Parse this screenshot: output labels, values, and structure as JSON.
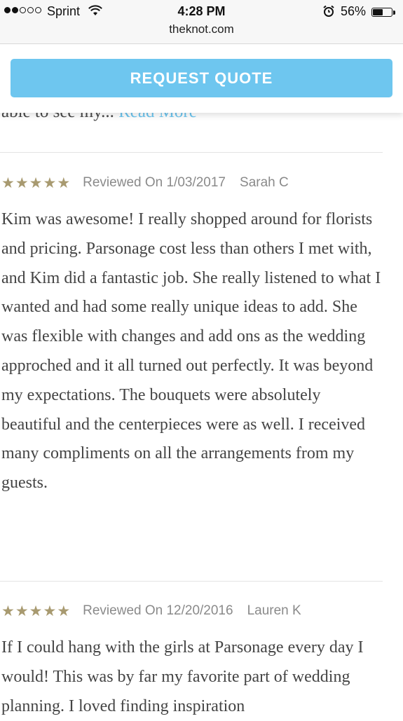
{
  "status_bar": {
    "carrier": "Sprint",
    "time": "4:28 PM",
    "battery_percent": "56%",
    "battery_level": 0.56,
    "url": "theknot.com"
  },
  "cta": {
    "label": "REQUEST QUOTE"
  },
  "previous_review": {
    "text_fragment": "able to see my...",
    "read_more": "Read More"
  },
  "reviews": [
    {
      "rating": 5,
      "reviewed_on": "Reviewed On 1/03/2017",
      "author": "Sarah C",
      "text": "Kim was awesome! I really shopped around for florists and pricing. Parsonage cost less than others I met with, and Kim did a fantastic job. She really listened to what I wanted and had some really unique ideas to add. She was flexible with changes and add ons as the wedding approched and it all turned out perfectly. It was beyond my expectations. The bouquets were absolutely beautiful and the centerpieces were as well. I received many compliments on all the arrangements from my guests."
    },
    {
      "rating": 5,
      "reviewed_on": "Reviewed On 12/20/2016",
      "author": "Lauren K",
      "text": "If I could hang with the girls at Parsonage every day I would! This was by far my favorite part of wedding planning. I loved finding inspiration"
    }
  ],
  "colors": {
    "accent": "#6ec6ef",
    "star": "#a89a70",
    "meta_text": "#8a8a8a",
    "body_text": "#444444"
  }
}
